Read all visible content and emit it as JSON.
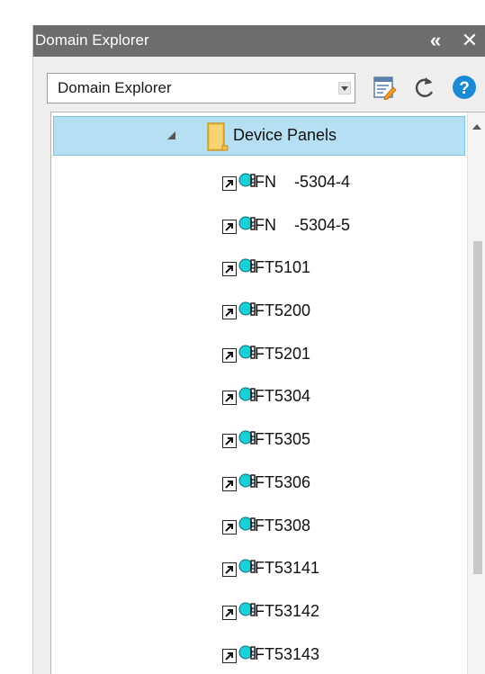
{
  "panel": {
    "title": "Domain Explorer",
    "collapse_label": "«",
    "close_label": "✕"
  },
  "toolbar": {
    "selector_value": "Domain Explorer",
    "icons": [
      "edit-list-icon",
      "refresh-icon",
      "help-icon"
    ]
  },
  "tree": {
    "group": {
      "label": "Device Panels",
      "expanded": true
    },
    "items": [
      {
        "label": "FN    -5304-4"
      },
      {
        "label": "FN    -5304-5"
      },
      {
        "label": "FT5101"
      },
      {
        "label": "FT5200"
      },
      {
        "label": "FT5201"
      },
      {
        "label": "FT5304"
      },
      {
        "label": "FT5305"
      },
      {
        "label": "FT5306"
      },
      {
        "label": "FT5308"
      },
      {
        "label": "FT53141"
      },
      {
        "label": "FT53142"
      },
      {
        "label": "FT53143"
      }
    ]
  },
  "colors": {
    "titlebar": "#6d6d6d",
    "selection": "#b7dff4",
    "lamp": "#1ad0d8",
    "help": "#1a8ad4"
  }
}
